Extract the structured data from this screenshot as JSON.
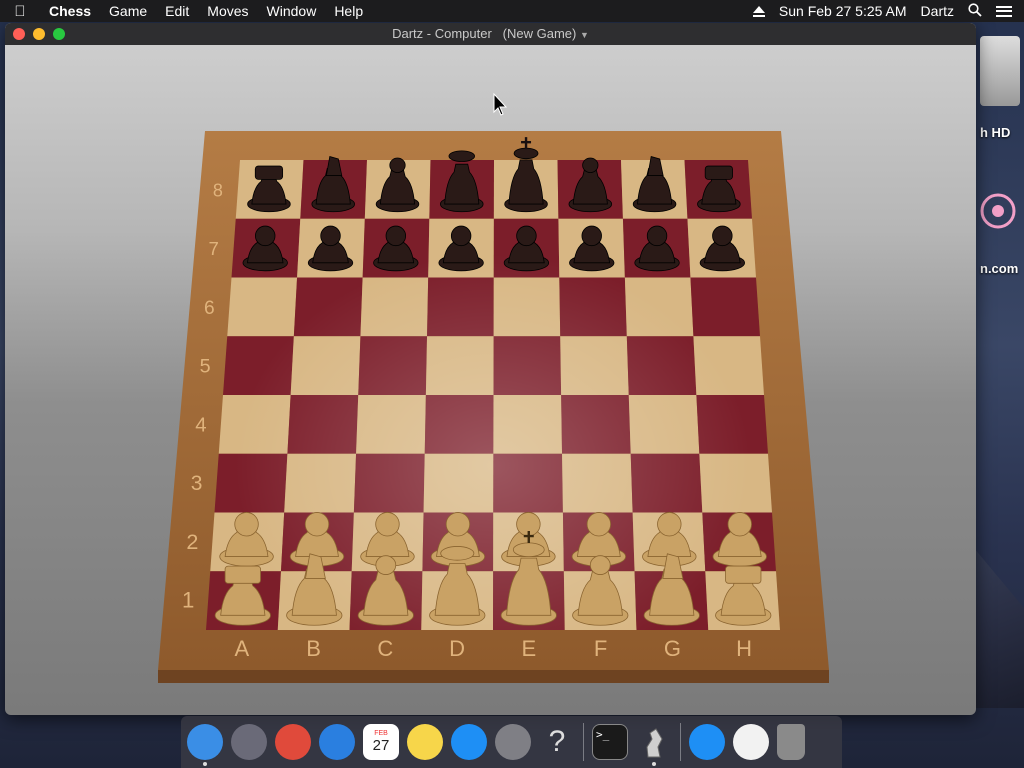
{
  "menubar": {
    "app_name": "Chess",
    "menus": [
      "Game",
      "Edit",
      "Moves",
      "Window",
      "Help"
    ],
    "datetime": "Sun Feb 27  5:25 AM",
    "user": "Dartz"
  },
  "window": {
    "title": "Dartz - Computer",
    "subtitle": "(New Game)"
  },
  "desktop": {
    "icon_labels": [
      "h HD",
      "n.com"
    ]
  },
  "board": {
    "files": [
      "A",
      "B",
      "C",
      "D",
      "E",
      "F",
      "G",
      "H"
    ],
    "ranks": [
      "8",
      "7",
      "6",
      "5",
      "4",
      "3",
      "2",
      "1"
    ],
    "colors": {
      "light_square": "#d8b784",
      "dark_square": "#7c1e2a",
      "frame": "#b7773e",
      "white_piece": "#c9a265",
      "black_piece": "#2a1a17"
    },
    "position": {
      "rank8": [
        "rook",
        "knight",
        "bishop",
        "queen",
        "king",
        "bishop",
        "knight",
        "rook"
      ],
      "rank7": [
        "pawn",
        "pawn",
        "pawn",
        "pawn",
        "pawn",
        "pawn",
        "pawn",
        "pawn"
      ],
      "rank2": [
        "pawn",
        "pawn",
        "pawn",
        "pawn",
        "pawn",
        "pawn",
        "pawn",
        "pawn"
      ],
      "rank1": [
        "rook",
        "knight",
        "bishop",
        "queen",
        "king",
        "bishop",
        "knight",
        "rook"
      ]
    }
  },
  "dock": {
    "items": [
      {
        "name": "finder-icon",
        "label": "Finder",
        "color": "#3a8ee6"
      },
      {
        "name": "launchpad-icon",
        "label": "Launchpad",
        "color": "#6a6a78"
      },
      {
        "name": "chrome-icon",
        "label": "Chrome",
        "color": "#e04a3b"
      },
      {
        "name": "safari-icon",
        "label": "Safari",
        "color": "#2a7fe0"
      },
      {
        "name": "calendar-icon",
        "label": "Calendar",
        "color": "#ffffff",
        "text": "27",
        "month": "FEB"
      },
      {
        "name": "notes-icon",
        "label": "Notes",
        "color": "#f7d64a"
      },
      {
        "name": "app-store-icon",
        "label": "App Store",
        "color": "#1e8ff5"
      },
      {
        "name": "system-preferences-icon",
        "label": "System Preferences",
        "color": "#7f7f85"
      },
      {
        "name": "help-icon",
        "label": "Help",
        "color": "transparent",
        "text": "?"
      },
      {
        "name": "terminal-icon",
        "label": "Terminal",
        "color": "#1a1a1a",
        "text": ">_"
      },
      {
        "name": "chess-icon",
        "label": "Chess",
        "color": "transparent"
      },
      {
        "name": "app-store-downloads-icon",
        "label": "App Store",
        "color": "#1e8ff5"
      },
      {
        "name": "document-icon",
        "label": "Document",
        "color": "#f2f2f2"
      },
      {
        "name": "trash-icon",
        "label": "Trash",
        "color": "#8a8a8a"
      }
    ]
  }
}
